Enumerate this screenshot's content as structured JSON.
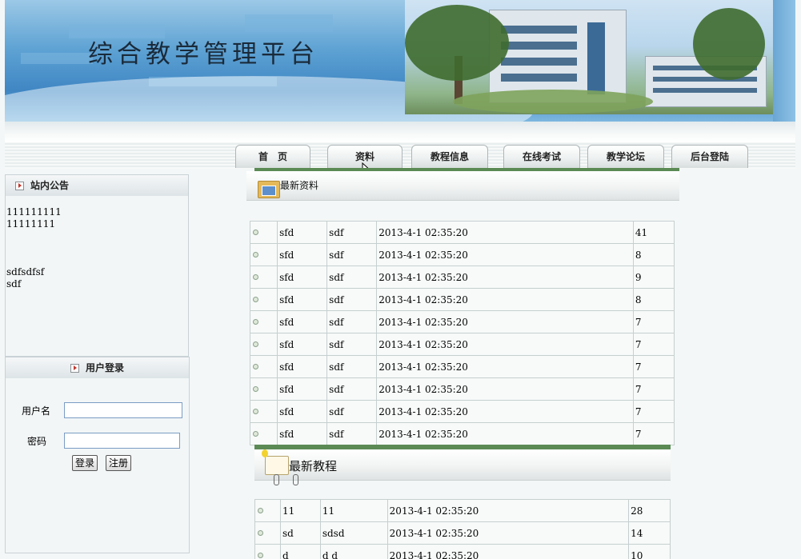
{
  "banner": {
    "title": "综合教学管理平台"
  },
  "nav": [
    {
      "label": "首　页"
    },
    {
      "label": "资料"
    },
    {
      "label": "教程信息"
    },
    {
      "label": "在线考试"
    },
    {
      "label": "教学论坛"
    },
    {
      "label": "后台登陆"
    }
  ],
  "notice": {
    "title": "站内公告",
    "lines": [
      "111111111",
      "11111111",
      "",
      "",
      "",
      "sdfsdfsf",
      "sdf"
    ]
  },
  "login": {
    "title": "用户登录",
    "username_label": "用户名",
    "password_label": "密码",
    "username_value": "",
    "password_value": "",
    "login_button": "登录",
    "register_button": "注册"
  },
  "materials": {
    "title": "最新资料",
    "rows": [
      [
        "sfd",
        "sdf",
        "2013-4-1 02:35:20",
        "41"
      ],
      [
        "sfd",
        "sdf",
        "2013-4-1 02:35:20",
        "8"
      ],
      [
        "sfd",
        "sdf",
        "2013-4-1 02:35:20",
        "9"
      ],
      [
        "sfd",
        "sdf",
        "2013-4-1 02:35:20",
        "8"
      ],
      [
        "sfd",
        "sdf",
        "2013-4-1 02:35:20",
        "7"
      ],
      [
        "sfd",
        "sdf",
        "2013-4-1 02:35:20",
        "7"
      ],
      [
        "sfd",
        "sdf",
        "2013-4-1 02:35:20",
        "7"
      ],
      [
        "sfd",
        "sdf",
        "2013-4-1 02:35:20",
        "7"
      ],
      [
        "sfd",
        "sdf",
        "2013-4-1 02:35:20",
        "7"
      ],
      [
        "sfd",
        "sdf",
        "2013-4-1 02:35:20",
        "7"
      ]
    ]
  },
  "tutorials": {
    "title": "最新教程",
    "rows": [
      [
        "11",
        "11",
        "2013-4-1 02:35:20",
        "28"
      ],
      [
        "sd",
        "sdsd",
        "2013-4-1 02:35:20",
        "14"
      ],
      [
        "d",
        "d d",
        "2013-4-1 02:35:20",
        "10"
      ]
    ]
  },
  "colors": {
    "section_bar": "#5b8a55",
    "banner_blue": "#3f86c3"
  }
}
